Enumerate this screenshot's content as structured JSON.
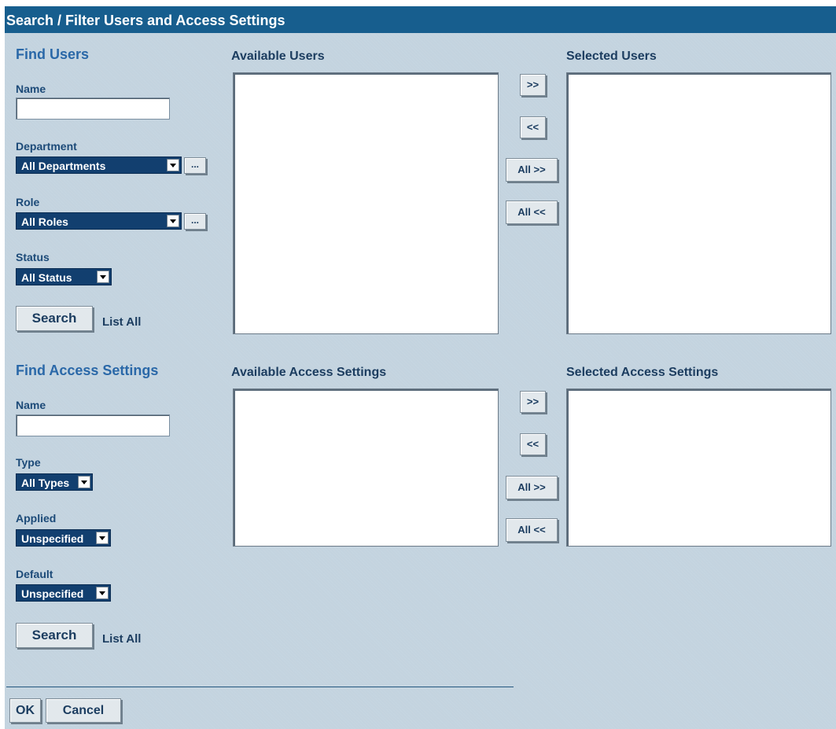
{
  "window": {
    "title": "Search / Filter Users and Access Settings"
  },
  "find_users": {
    "title": "Find Users",
    "name_label": "Name",
    "name_value": "",
    "department_label": "Department",
    "department_value": "All Departments",
    "role_label": "Role",
    "role_value": "All Roles",
    "status_label": "Status",
    "status_value": "All Status",
    "ellipsis_label": "...",
    "search_label": "Search",
    "list_all_label": "List All"
  },
  "users_transfer": {
    "available_title": "Available Users",
    "selected_title": "Selected Users",
    "available_items": [],
    "selected_items": [],
    "add_label": ">>",
    "remove_label": "<<",
    "add_all_label": "All >>",
    "remove_all_label": "All <<"
  },
  "find_access": {
    "title": "Find Access Settings",
    "name_label": "Name",
    "name_value": "",
    "type_label": "Type",
    "type_value": "All Types",
    "applied_label": "Applied",
    "applied_value": "Unspecified",
    "default_label": "Default",
    "default_value": "Unspecified",
    "search_label": "Search",
    "list_all_label": "List All"
  },
  "access_transfer": {
    "available_title": "Available Access Settings",
    "selected_title": "Selected Access Settings",
    "available_items": [],
    "selected_items": [],
    "add_label": ">>",
    "remove_label": "<<",
    "add_all_label": "All >>",
    "remove_all_label": "All <<"
  },
  "footer": {
    "ok_label": "OK",
    "cancel_label": "Cancel"
  },
  "colors": {
    "panel_bg": "#c3d3df",
    "titlebar_bg": "#175e8e",
    "select_bg": "#123f6f",
    "section_title": "#2a68a8"
  }
}
